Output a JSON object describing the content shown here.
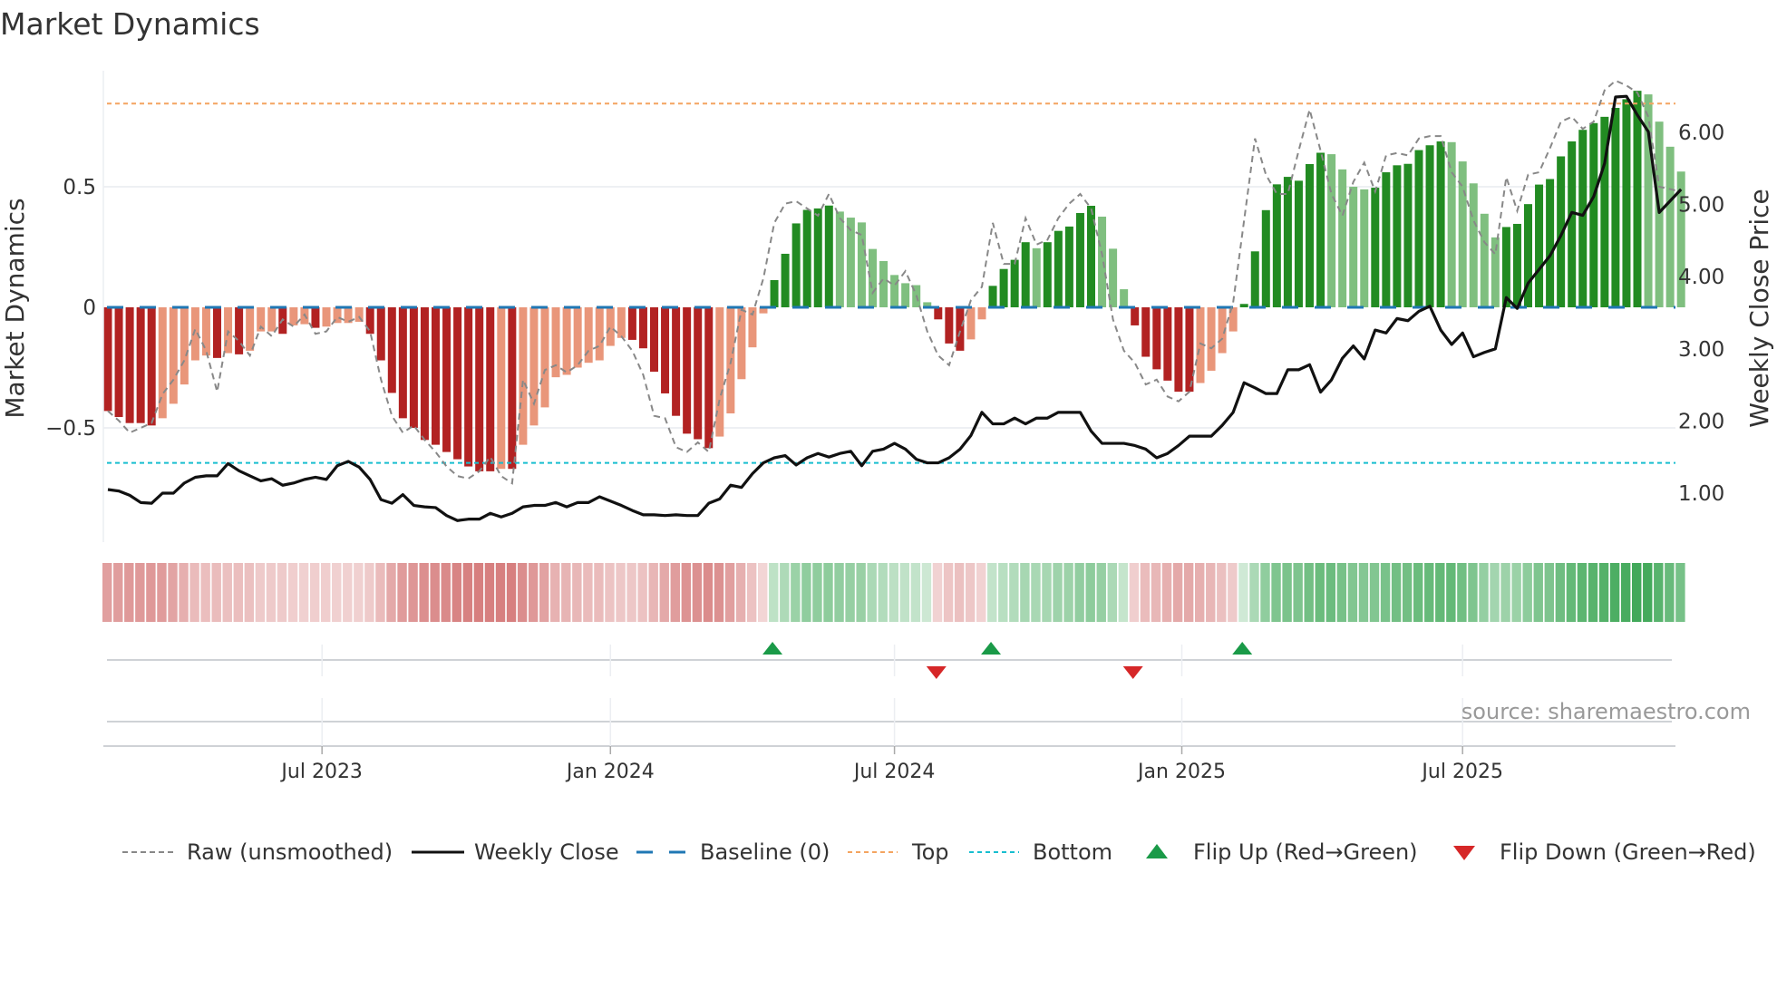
{
  "chart_data": {
    "type": "bar",
    "title": "Market Dynamics",
    "ylabel": "Market Dynamics",
    "y2label": "Weekly Close Price",
    "source": "source: sharemaestro.com",
    "ylim": [
      -0.92,
      1.0
    ],
    "y2lim": [
      0.2,
      7.2
    ],
    "yticks": [
      {
        "v": 0.5,
        "label": "0.5"
      },
      {
        "v": 0,
        "label": "0"
      },
      {
        "v": -0.5,
        "label": "−0.5"
      }
    ],
    "y2ticks": [
      {
        "v": 6,
        "label": "6.00"
      },
      {
        "v": 5,
        "label": "5.00"
      },
      {
        "v": 4,
        "label": "4.00"
      },
      {
        "v": 3,
        "label": "3.00"
      },
      {
        "v": 2,
        "label": "2.00"
      },
      {
        "v": 1,
        "label": "1.00"
      }
    ],
    "xticks": [
      {
        "week": 20.6,
        "label": "Jul 2023"
      },
      {
        "week": 47.0,
        "label": "Jan 2024"
      },
      {
        "week": 73.0,
        "label": "Jul 2024"
      },
      {
        "week": 99.3,
        "label": "Jan 2025"
      },
      {
        "week": 125.0,
        "label": "Jul 2025"
      }
    ],
    "top": 0.845,
    "bottom": -0.645,
    "baseline": 0,
    "colors": {
      "red_dark": "#b22222",
      "red_light": "#e9967a",
      "green_dark": "#228b22",
      "green_light": "#7fbf7f",
      "raw": "#888888",
      "close": "#111111",
      "baseline": "#1f77b4",
      "top": "#f4a460",
      "bottom": "#17becf",
      "flip_up": "#1a9a48",
      "flip_down": "#d62728"
    },
    "dynamics": [
      -0.43,
      -0.455,
      -0.48,
      -0.48,
      -0.49,
      -0.46,
      -0.4,
      -0.32,
      -0.22,
      -0.2,
      -0.21,
      -0.19,
      -0.195,
      -0.18,
      -0.1,
      -0.1,
      -0.11,
      -0.075,
      -0.07,
      -0.085,
      -0.08,
      -0.065,
      -0.065,
      -0.06,
      -0.11,
      -0.22,
      -0.355,
      -0.46,
      -0.5,
      -0.55,
      -0.57,
      -0.6,
      -0.63,
      -0.66,
      -0.68,
      -0.68,
      -0.67,
      -0.67,
      -0.57,
      -0.49,
      -0.415,
      -0.29,
      -0.28,
      -0.25,
      -0.23,
      -0.22,
      -0.16,
      -0.127,
      -0.135,
      -0.17,
      -0.267,
      -0.357,
      -0.45,
      -0.524,
      -0.547,
      -0.584,
      -0.536,
      -0.44,
      -0.298,
      -0.166,
      -0.025,
      0.113,
      0.222,
      0.348,
      0.404,
      0.41,
      0.422,
      0.397,
      0.372,
      0.352,
      0.242,
      0.192,
      0.134,
      0.1,
      0.092,
      0.021,
      -0.05,
      -0.15,
      -0.18,
      -0.133,
      -0.05,
      0.089,
      0.159,
      0.197,
      0.27,
      0.245,
      0.27,
      0.317,
      0.335,
      0.391,
      0.421,
      0.376,
      0.243,
      0.075,
      -0.075,
      -0.205,
      -0.257,
      -0.304,
      -0.35,
      -0.35,
      -0.314,
      -0.263,
      -0.19,
      -0.1,
      0.014,
      0.232,
      0.403,
      0.51,
      0.541,
      0.525,
      0.594,
      0.641,
      0.635,
      0.572,
      0.5,
      0.489,
      0.496,
      0.56,
      0.589,
      0.595,
      0.652,
      0.672,
      0.688,
      0.685,
      0.605,
      0.514,
      0.388,
      0.29,
      0.333,
      0.346,
      0.428,
      0.509,
      0.532,
      0.626,
      0.688,
      0.736,
      0.764,
      0.79,
      0.827,
      0.863,
      0.898,
      0.883,
      0.77,
      0.666,
      0.563
    ],
    "shade": "DDDDDLLLLLDLDLLLDLLDLLLLDDDDDDDDDDDDLDLLLLLLLLLLDDDDDDDDLLLLLDDDDDDLLLLLLLLLDDDLLDDDDLDDDDDLLLDDDDDDLLLLDDDDDDDDLLLLDDDDDDDLLLLLDDDDDDDDDDDDDLLLL",
    "raw": [
      -0.43,
      -0.47,
      -0.52,
      -0.5,
      -0.48,
      -0.36,
      -0.3,
      -0.22,
      -0.09,
      -0.18,
      -0.35,
      -0.1,
      -0.14,
      -0.2,
      -0.08,
      -0.12,
      -0.05,
      -0.08,
      -0.03,
      -0.11,
      -0.1,
      -0.04,
      -0.06,
      -0.04,
      -0.1,
      -0.3,
      -0.45,
      -0.52,
      -0.49,
      -0.55,
      -0.6,
      -0.66,
      -0.7,
      -0.71,
      -0.68,
      -0.62,
      -0.7,
      -0.73,
      -0.3,
      -0.4,
      -0.26,
      -0.24,
      -0.27,
      -0.24,
      -0.18,
      -0.16,
      -0.08,
      -0.12,
      -0.18,
      -0.28,
      -0.45,
      -0.46,
      -0.58,
      -0.6,
      -0.56,
      -0.6,
      -0.38,
      -0.23,
      -0.01,
      -0.03,
      0.12,
      0.35,
      0.43,
      0.44,
      0.41,
      0.38,
      0.47,
      0.37,
      0.32,
      0.3,
      0.06,
      0.12,
      0.09,
      0.15,
      0.05,
      -0.1,
      -0.2,
      -0.24,
      -0.1,
      0.03,
      0.085,
      0.35,
      0.18,
      0.18,
      0.37,
      0.26,
      0.28,
      0.37,
      0.43,
      0.47,
      0.41,
      0.22,
      -0.05,
      -0.18,
      -0.23,
      -0.32,
      -0.3,
      -0.37,
      -0.39,
      -0.35,
      -0.15,
      -0.17,
      -0.13,
      0.02,
      0.36,
      0.7,
      0.55,
      0.47,
      0.47,
      0.65,
      0.82,
      0.65,
      0.47,
      0.38,
      0.52,
      0.6,
      0.48,
      0.63,
      0.64,
      0.63,
      0.7,
      0.71,
      0.71,
      0.56,
      0.5,
      0.36,
      0.27,
      0.22,
      0.54,
      0.4,
      0.55,
      0.56,
      0.66,
      0.77,
      0.79,
      0.74,
      0.77,
      0.9,
      0.94,
      0.92,
      0.89,
      0.79,
      0.5,
      0.49,
      0.48
    ],
    "close": [
      1.05,
      1.03,
      0.97,
      0.87,
      0.86,
      1.0,
      1.0,
      1.14,
      1.22,
      1.24,
      1.24,
      1.41,
      1.31,
      1.24,
      1.17,
      1.2,
      1.11,
      1.14,
      1.19,
      1.22,
      1.19,
      1.38,
      1.44,
      1.36,
      1.19,
      0.91,
      0.86,
      0.98,
      0.83,
      0.81,
      0.8,
      0.69,
      0.62,
      0.64,
      0.64,
      0.72,
      0.67,
      0.72,
      0.81,
      0.83,
      0.83,
      0.87,
      0.81,
      0.87,
      0.87,
      0.95,
      0.89,
      0.83,
      0.76,
      0.7,
      0.7,
      0.69,
      0.7,
      0.69,
      0.69,
      0.86,
      0.92,
      1.11,
      1.08,
      1.27,
      1.42,
      1.49,
      1.52,
      1.39,
      1.49,
      1.55,
      1.5,
      1.55,
      1.58,
      1.38,
      1.58,
      1.61,
      1.69,
      1.61,
      1.47,
      1.42,
      1.42,
      1.49,
      1.61,
      1.8,
      2.12,
      1.96,
      1.96,
      2.04,
      1.96,
      2.04,
      2.04,
      2.12,
      2.12,
      2.12,
      1.86,
      1.69,
      1.69,
      1.69,
      1.66,
      1.61,
      1.49,
      1.55,
      1.66,
      1.79,
      1.79,
      1.79,
      1.94,
      2.12,
      2.53,
      2.46,
      2.38,
      2.38,
      2.71,
      2.71,
      2.78,
      2.4,
      2.57,
      2.87,
      3.04,
      2.86,
      3.26,
      3.22,
      3.42,
      3.39,
      3.52,
      3.59,
      3.26,
      3.06,
      3.22,
      2.89,
      2.95,
      3.0,
      3.71,
      3.56,
      3.91,
      4.1,
      4.29,
      4.57,
      4.89,
      4.85,
      5.11,
      5.57,
      6.49,
      6.5,
      6.24,
      6.01,
      4.89,
      5.05,
      5.21
    ],
    "flips_up": [
      62,
      82,
      105
    ],
    "flips_down": [
      77,
      95
    ],
    "legend": [
      {
        "key": "raw",
        "label": "Raw (unsmoothed)"
      },
      {
        "key": "close",
        "label": "Weekly Close"
      },
      {
        "key": "baseline",
        "label": "Baseline (0)"
      },
      {
        "key": "top",
        "label": "Top"
      },
      {
        "key": "bottom",
        "label": "Bottom"
      },
      {
        "key": "flip_up",
        "label": "Flip Up (Red→Green)"
      },
      {
        "key": "flip_down",
        "label": "Flip Down (Green→Red)"
      }
    ],
    "legend_placement": "bottom"
  }
}
